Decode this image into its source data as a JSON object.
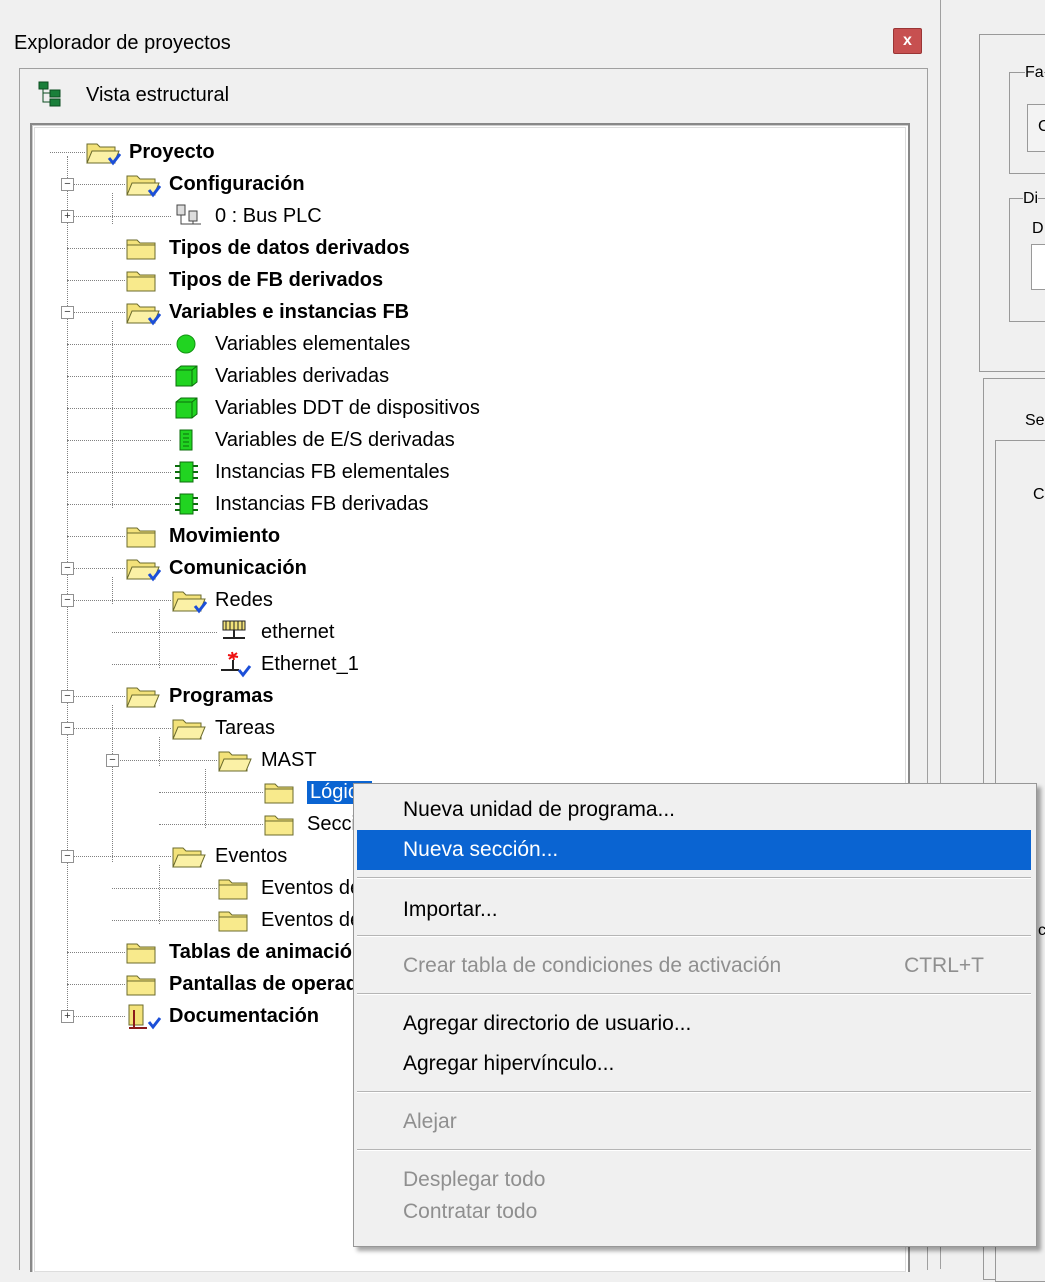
{
  "window": {
    "title": "Explorador de proyectos",
    "close": "x"
  },
  "view_label": "Vista estructural",
  "tree": [
    {
      "label": "Proyecto",
      "bold": true
    },
    {
      "label": "Configuración",
      "bold": true
    },
    {
      "label": "0 : Bus PLC",
      "bold": false
    },
    {
      "label": "Tipos de datos derivados",
      "bold": true
    },
    {
      "label": "Tipos de FB derivados",
      "bold": true
    },
    {
      "label": "Variables e instancias FB",
      "bold": true
    },
    {
      "label": "Variables elementales",
      "bold": false
    },
    {
      "label": "Variables derivadas",
      "bold": false
    },
    {
      "label": "Variables DDT de dispositivos",
      "bold": false
    },
    {
      "label": "Variables de E/S derivadas",
      "bold": false
    },
    {
      "label": "Instancias FB elementales",
      "bold": false
    },
    {
      "label": "Instancias FB derivadas",
      "bold": false
    },
    {
      "label": "Movimiento",
      "bold": true
    },
    {
      "label": "Comunicación",
      "bold": true
    },
    {
      "label": "Redes",
      "bold": false
    },
    {
      "label": "ethernet",
      "bold": false
    },
    {
      "label": "Ethernet_1",
      "bold": false
    },
    {
      "label": "Programas",
      "bold": true
    },
    {
      "label": "Tareas",
      "bold": false
    },
    {
      "label": "MAST",
      "bold": false
    },
    {
      "label": "Lógica",
      "bold": false,
      "selected": true
    },
    {
      "label": "Secciones",
      "bold": false
    },
    {
      "label": "Eventos",
      "bold": false
    },
    {
      "label": "Eventos de temporizador",
      "bold": false
    },
    {
      "label": "Eventos de E/S",
      "bold": false
    },
    {
      "label": "Tablas de animación",
      "bold": true
    },
    {
      "label": "Pantallas de operador",
      "bold": true
    },
    {
      "label": "Documentación",
      "bold": true
    }
  ],
  "context_menu": {
    "items": [
      {
        "label": "Nueva unidad de programa...",
        "shortcut": "",
        "disabled": false
      },
      {
        "label": "Nueva sección...",
        "shortcut": "",
        "disabled": false,
        "highlighted": true
      },
      {
        "label": "Importar...",
        "shortcut": "",
        "disabled": false
      },
      {
        "label": "Crear tabla de condiciones de activación",
        "shortcut": "CTRL+T",
        "disabled": true
      },
      {
        "label": "Agregar directorio de usuario...",
        "shortcut": "",
        "disabled": false
      },
      {
        "label": "Agregar hipervínculo...",
        "shortcut": "",
        "disabled": false
      },
      {
        "label": "Alejar",
        "shortcut": "",
        "disabled": true
      },
      {
        "label": "Desplegar todo",
        "shortcut": "",
        "disabled": true
      },
      {
        "label": "Contratar todo",
        "shortcut": "",
        "disabled": true
      }
    ]
  },
  "right_panel": {
    "labels": [
      "Fa",
      "C",
      "Di",
      "D",
      "Se",
      "C",
      "c"
    ]
  },
  "colors": {
    "selection": "#0a64d2",
    "folder": "#f3e27a",
    "green": "#21d421",
    "close_button": "#c75050"
  }
}
